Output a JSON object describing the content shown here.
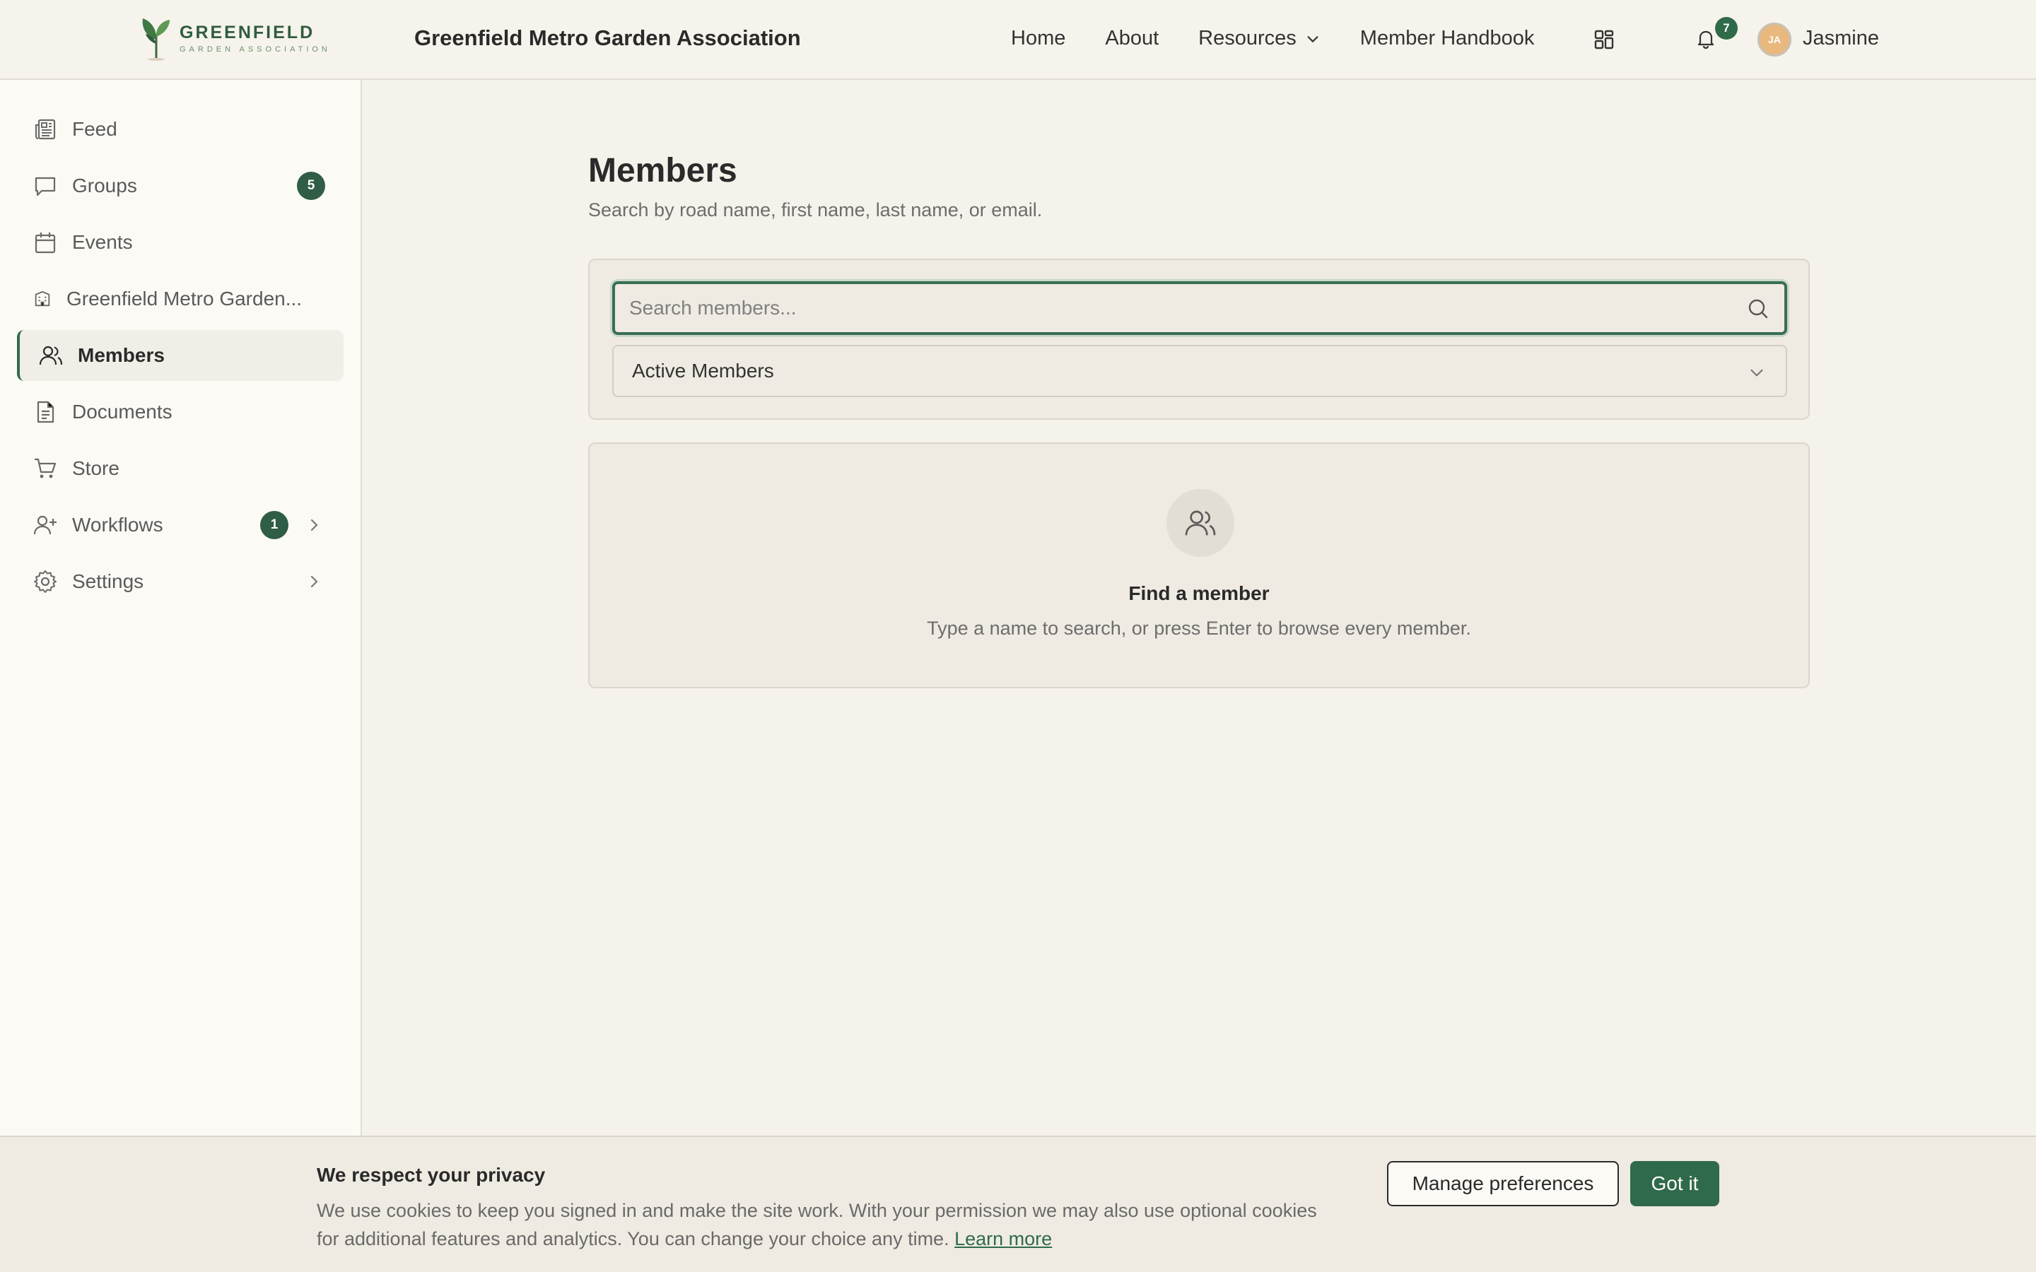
{
  "header": {
    "logo_main": "GREENFIELD",
    "logo_sub": "GARDEN ASSOCIATION",
    "site_title": "Greenfield Metro Garden Association",
    "nav": [
      {
        "label": "Home"
      },
      {
        "label": "About"
      },
      {
        "label": "Resources",
        "has_dropdown": true
      },
      {
        "label": "Member Handbook"
      }
    ],
    "apps_icon": "grid-icon",
    "notifications_count": "7",
    "avatar_initials": "JA",
    "avatar_color": "#e8b87e",
    "username": "Jasmine"
  },
  "sidebar": {
    "items": [
      {
        "label": "Feed",
        "icon": "newspaper-icon"
      },
      {
        "label": "Groups",
        "icon": "chat-icon",
        "badge": "5"
      },
      {
        "label": "Events",
        "icon": "calendar-icon"
      },
      {
        "label": "Greenfield Metro Garden...",
        "icon": "building-icon"
      },
      {
        "label": "Members",
        "icon": "users-icon",
        "active": true
      },
      {
        "label": "Documents",
        "icon": "document-icon"
      },
      {
        "label": "Store",
        "icon": "cart-icon"
      },
      {
        "label": "Workflows",
        "icon": "user-plus-icon",
        "badge": "1",
        "expandable": true
      },
      {
        "label": "Settings",
        "icon": "gear-icon",
        "expandable": true
      }
    ]
  },
  "main": {
    "title": "Members",
    "subtitle": "Search by road name, first name, last name, or email.",
    "search": {
      "placeholder": "Search members...",
      "value": ""
    },
    "filter": {
      "selected": "Active Members"
    },
    "empty_state": {
      "icon": "users-icon",
      "title": "Find a member",
      "message": "Type a name to search, or press Enter to browse every member."
    }
  },
  "cookie_banner": {
    "title": "We respect your privacy",
    "text": "We use cookies to keep you signed in and make the site work. With your permission we may also use optional cookies for additional features and analytics. You can change your choice any time.",
    "link": "Learn more",
    "manage_label": "Manage preferences",
    "accept_label": "Got it"
  },
  "colors": {
    "accent": "#2f6b4a",
    "background": "#f5f2eb",
    "sidebar_bg": "#fcfaf5"
  }
}
